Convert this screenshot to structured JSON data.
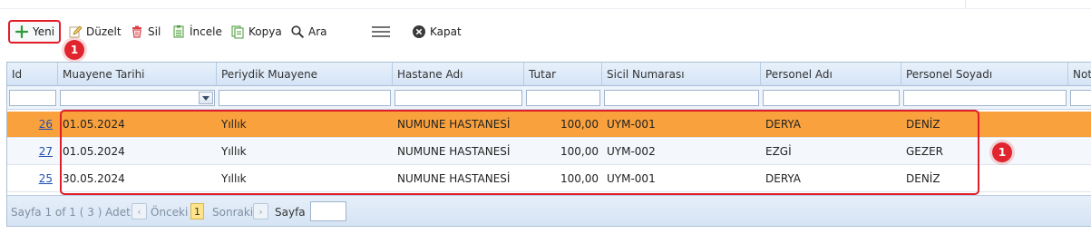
{
  "toolbar": {
    "new_label": "Yeni",
    "edit_label": "Düzelt",
    "delete_label": "Sil",
    "inspect_label": "İncele",
    "copy_label": "Kopya",
    "search_label": "Ara",
    "close_label": "Kapat"
  },
  "badges": {
    "new_badge": "1",
    "rows_badge": "1"
  },
  "grid": {
    "columns": [
      "Id",
      "Muayene Tarihi",
      "Periydik Muayene",
      "Hastane Adı",
      "Tutar",
      "Sicil Numarası",
      "Personel Adı",
      "Personel Soyadı",
      "Not"
    ],
    "rows": [
      {
        "id": "26",
        "date": "01.05.2024",
        "type": "Yıllık",
        "hospital": "NUMUNE HASTANESİ",
        "amount": "100,00",
        "sicil": "UYM-001",
        "name": "DERYA",
        "surname": "DENİZ",
        "note": ""
      },
      {
        "id": "27",
        "date": "01.05.2024",
        "type": "Yıllık",
        "hospital": "NUMUNE HASTANESİ",
        "amount": "100,00",
        "sicil": "UYM-002",
        "name": "EZGİ",
        "surname": "GEZER",
        "note": ""
      },
      {
        "id": "25",
        "date": "30.05.2024",
        "type": "Yıllık",
        "hospital": "NUMUNE HASTANESİ",
        "amount": "100,00",
        "sicil": "UYM-001",
        "name": "DERYA",
        "surname": "DENİZ",
        "note": ""
      }
    ]
  },
  "pager": {
    "summary": "Sayfa 1 of 1 ( 3 ) Adet",
    "prev_label": "Önceki",
    "current_page": "1",
    "next_label": "Sonraki",
    "page_label": "Sayfa"
  },
  "colors": {
    "selected_row": "#f9a13c",
    "highlight": "#e11d2a",
    "header": "#d4e4f6"
  }
}
